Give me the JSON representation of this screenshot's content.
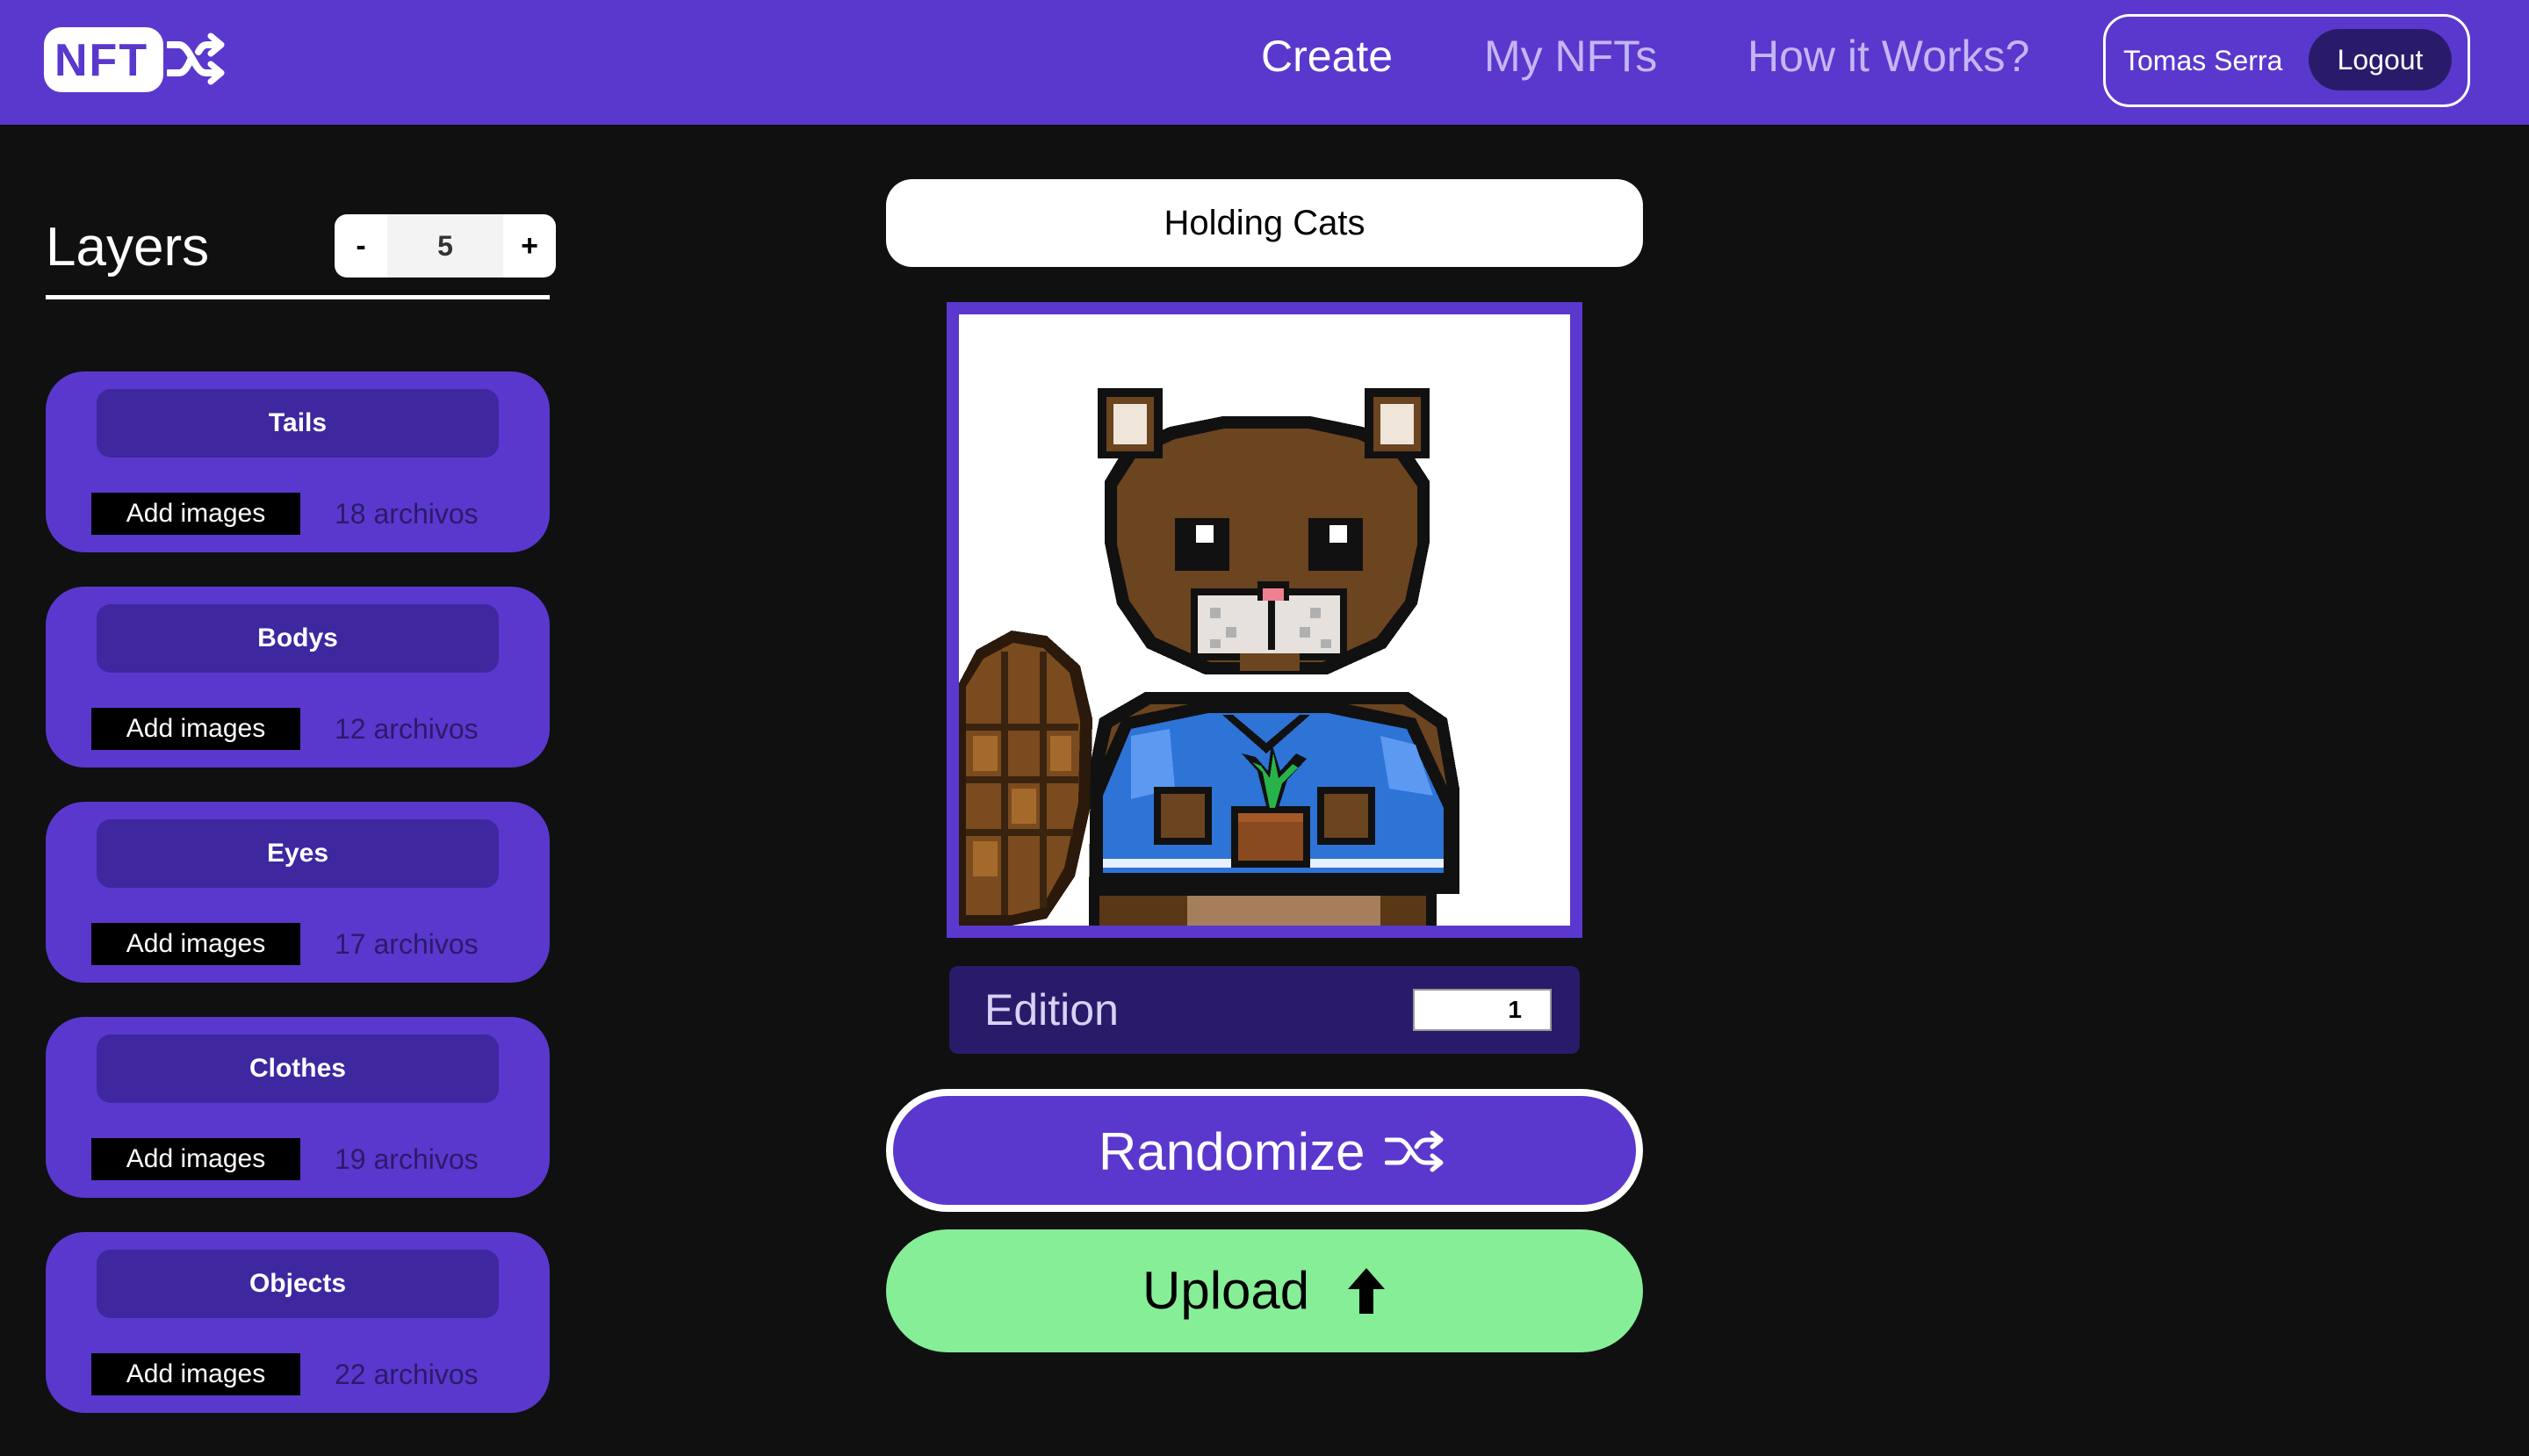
{
  "header": {
    "logo_text": "NFT",
    "nav": [
      {
        "label": "Create"
      },
      {
        "label": "My NFTs"
      },
      {
        "label": "How it Works?"
      }
    ],
    "user_name": "Tomas Serra",
    "logout_label": "Logout"
  },
  "layers": {
    "title": "Layers",
    "count": "5",
    "minus_label": "-",
    "plus_label": "+",
    "items": [
      {
        "name": "Tails",
        "add_label": "Add images",
        "files": "18 archivos"
      },
      {
        "name": "Bodys",
        "add_label": "Add images",
        "files": "12 archivos"
      },
      {
        "name": "Eyes",
        "add_label": "Add images",
        "files": "17 archivos"
      },
      {
        "name": "Clothes",
        "add_label": "Add images",
        "files": "19 archivos"
      },
      {
        "name": "Objects",
        "add_label": "Add images",
        "files": "22 archivos"
      }
    ]
  },
  "editor": {
    "collection_name": "Holding Cats",
    "edition_label": "Edition",
    "edition_value": "1",
    "randomize_label": "Randomize",
    "upload_label": "Upload"
  },
  "colors": {
    "brand": "#5a38cd",
    "brand_dark": "#2a1b6a",
    "upload_green": "#86ee97",
    "background": "#101010"
  },
  "icons": {
    "logo": "shuffle-icon",
    "randomize": "shuffle-icon",
    "upload": "arrow-up-icon",
    "preview": "beaver-character"
  }
}
